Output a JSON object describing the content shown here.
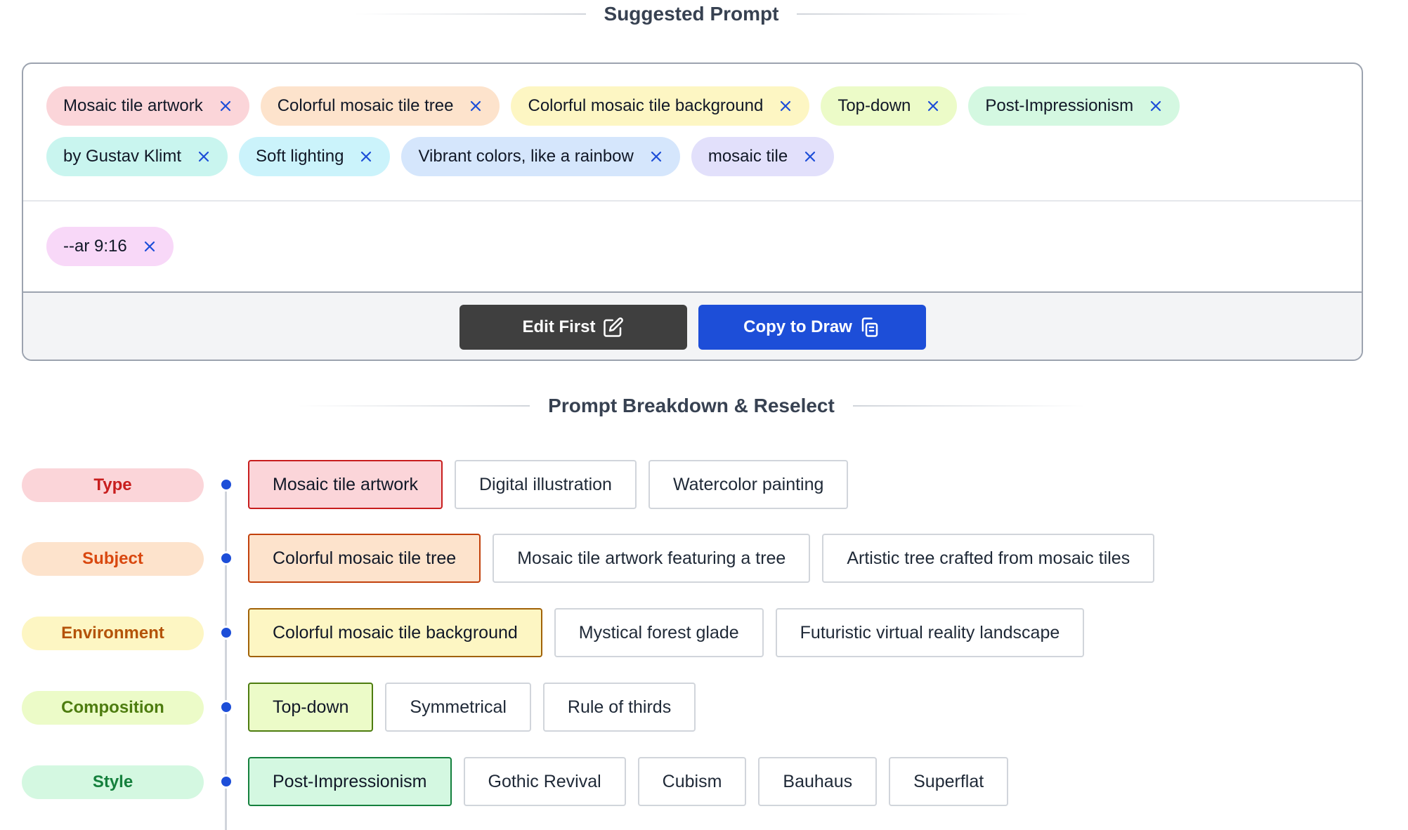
{
  "suggested": {
    "title": "Suggested Prompt",
    "chips": [
      {
        "label": "Mosaic tile artwork",
        "bg": "#fbd5d9"
      },
      {
        "label": "Colorful mosaic tile tree",
        "bg": "#fde3cc"
      },
      {
        "label": "Colorful mosaic tile background",
        "bg": "#fdf6c3"
      },
      {
        "label": "Top-down",
        "bg": "#ecfbc8"
      },
      {
        "label": "Post-Impressionism",
        "bg": "#d4f8e1"
      },
      {
        "label": "by Gustav Klimt",
        "bg": "#c9f5ef"
      },
      {
        "label": "Soft lighting",
        "bg": "#cbf3fb"
      },
      {
        "label": "Vibrant colors, like a rainbow",
        "bg": "#d5e6fc"
      },
      {
        "label": "mosaic tile",
        "bg": "#e2e0fb"
      }
    ],
    "params": [
      {
        "label": "--ar 9:16",
        "bg": "#f8d8f8"
      }
    ],
    "remove_icon": "close-icon",
    "edit_button": {
      "label": "Edit First",
      "icon": "edit-icon"
    },
    "copy_button": {
      "label": "Copy to Draw",
      "icon": "copy-icon"
    }
  },
  "breakdown": {
    "title": "Prompt Breakdown & Reselect",
    "accent": "#1d4ed8",
    "rows": [
      {
        "category": "Type",
        "label_bg": "#fbd5d9",
        "label_color": "#c81e1e",
        "sel_bg": "#fbd5d9",
        "sel_border": "#c81e1e",
        "options": [
          "Mosaic tile artwork",
          "Digital illustration",
          "Watercolor painting"
        ],
        "selected": 0
      },
      {
        "category": "Subject",
        "label_bg": "#fde3cc",
        "label_color": "#d9480f",
        "sel_bg": "#fde3cc",
        "sel_border": "#c2410c",
        "options": [
          "Colorful mosaic tile tree",
          "Mosaic tile artwork featuring a tree",
          "Artistic tree crafted from mosaic tiles"
        ],
        "selected": 0
      },
      {
        "category": "Environment",
        "label_bg": "#fdf6c3",
        "label_color": "#b45309",
        "sel_bg": "#fdf6c3",
        "sel_border": "#a16207",
        "options": [
          "Colorful mosaic tile background",
          "Mystical forest glade",
          "Futuristic virtual reality landscape"
        ],
        "selected": 0
      },
      {
        "category": "Composition",
        "label_bg": "#ecfbc8",
        "label_color": "#4d7c0f",
        "sel_bg": "#ecfbc8",
        "sel_border": "#4d7c0f",
        "options": [
          "Top-down",
          "Symmetrical",
          "Rule of thirds"
        ],
        "selected": 0
      },
      {
        "category": "Style",
        "label_bg": "#d4f8e1",
        "label_color": "#15803d",
        "sel_bg": "#d4f8e1",
        "sel_border": "#15803d",
        "options": [
          "Post-Impressionism",
          "Gothic Revival",
          "Cubism",
          "Bauhaus",
          "Superflat"
        ],
        "selected": 0
      }
    ]
  }
}
